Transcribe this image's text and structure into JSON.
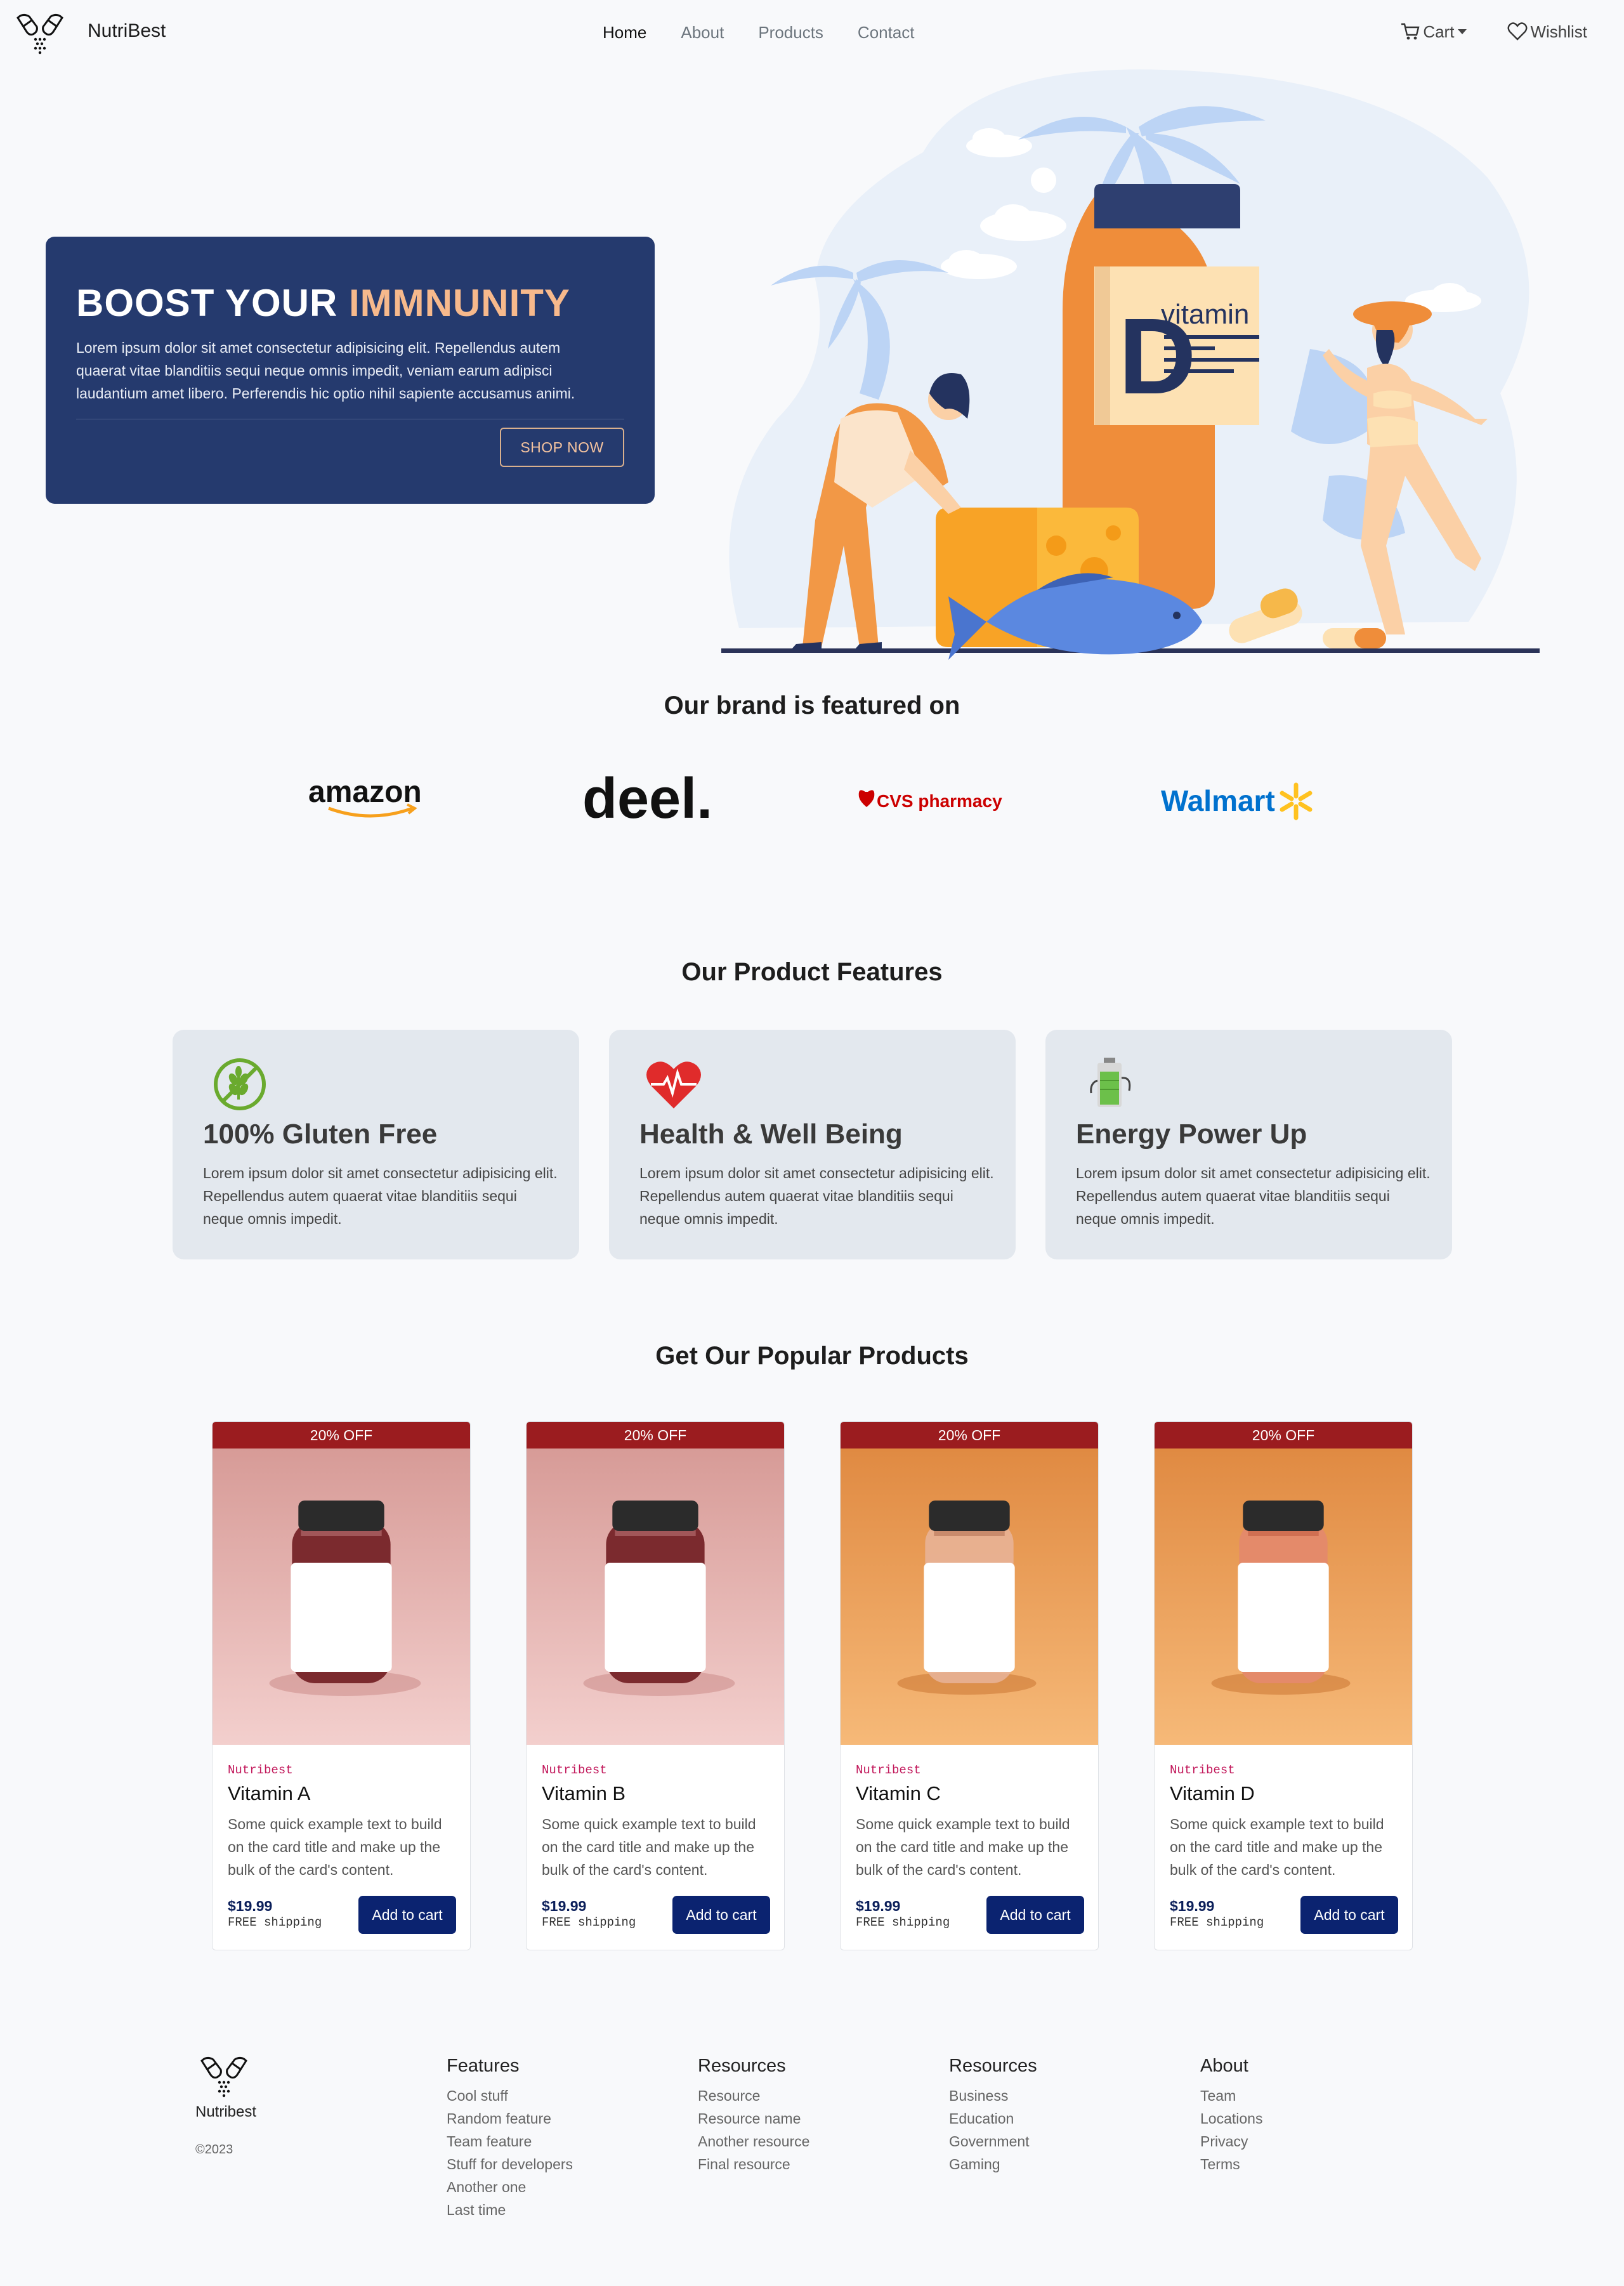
{
  "nav": {
    "brand": "NutriBest",
    "links": [
      "Home",
      "About",
      "Products",
      "Contact"
    ],
    "cart_label": "Cart",
    "wishlist_label": "Wishlist"
  },
  "hero": {
    "title_main": "BOOST YOUR ",
    "title_accent": "IMMNUNITY",
    "text": "Lorem ipsum dolor sit amet consectetur adipisicing elit. Repellendus autem quaerat vitae blanditiis sequi neque omnis impedit, veniam earum adipisci laudantium amet libero. Perferendis hic optio nihil sapiente accusamus animi.",
    "button": "SHOP NOW",
    "illustration_text": {
      "letter": "D",
      "word": "vitamin"
    }
  },
  "featured": {
    "title": "Our brand is featured on",
    "logos": [
      "amazon",
      "deel.",
      "CVS pharmacy",
      "Walmart"
    ]
  },
  "features": {
    "title": "Our Product Features",
    "items": [
      {
        "icon": "gluten-free-icon",
        "title": "100% Gluten Free",
        "text": "Lorem ipsum dolor sit amet consectetur adipisicing elit. Repellendus autem quaerat vitae blanditiis sequi neque omnis impedit."
      },
      {
        "icon": "heart-pulse-icon",
        "title": "Health & Well Being",
        "text": "Lorem ipsum dolor sit amet consectetur adipisicing elit. Repellendus autem quaerat vitae blanditiis sequi neque omnis impedit."
      },
      {
        "icon": "battery-icon",
        "title": "Energy Power Up",
        "text": "Lorem ipsum dolor sit amet consectetur adipisicing elit. Repellendus autem quaerat vitae blanditiis sequi neque omnis impedit."
      }
    ]
  },
  "products": {
    "title": "Get Our Popular Products",
    "items": [
      {
        "badge": "20% OFF",
        "brand": "Nutribest",
        "name": "Vitamin A",
        "desc": "Some quick example text to build on the card title and make up the bulk of the card's content.",
        "price": "$19.99",
        "shipping": "FREE shipping",
        "button": "Add to cart"
      },
      {
        "badge": "20% OFF",
        "brand": "Nutribest",
        "name": "Vitamin B",
        "desc": "Some quick example text to build on the card title and make up the bulk of the card's content.",
        "price": "$19.99",
        "shipping": "FREE shipping",
        "button": "Add to cart"
      },
      {
        "badge": "20% OFF",
        "brand": "Nutribest",
        "name": "Vitamin C",
        "desc": "Some quick example text to build on the card title and make up the bulk of the card's content.",
        "price": "$19.99",
        "shipping": "FREE shipping",
        "button": "Add to cart"
      },
      {
        "badge": "20% OFF",
        "brand": "Nutribest",
        "name": "Vitamin D",
        "desc": "Some quick example text to build on the card title and make up the bulk of the card's content.",
        "price": "$19.99",
        "shipping": "FREE shipping",
        "button": "Add to cart"
      }
    ]
  },
  "footer": {
    "brand": "Nutribest",
    "copyright": "©2023",
    "columns": [
      {
        "title": "Features",
        "links": [
          "Cool stuff",
          "Random feature",
          "Team feature",
          "Stuff for developers",
          "Another one",
          "Last time"
        ]
      },
      {
        "title": "Resources",
        "links": [
          "Resource",
          "Resource name",
          "Another resource",
          "Final resource"
        ]
      },
      {
        "title": "Resources",
        "links": [
          "Business",
          "Education",
          "Government",
          "Gaming"
        ]
      },
      {
        "title": "About",
        "links": [
          "Team",
          "Locations",
          "Privacy",
          "Terms"
        ]
      }
    ]
  },
  "colors": {
    "hero_bg": "#253a6e",
    "accent_peach": "#f7b98c",
    "badge_red": "#9b1c1f",
    "button_navy": "#0b2370",
    "feature_card_bg": "#e3e8ee",
    "brand_pink": "#c2185b"
  }
}
